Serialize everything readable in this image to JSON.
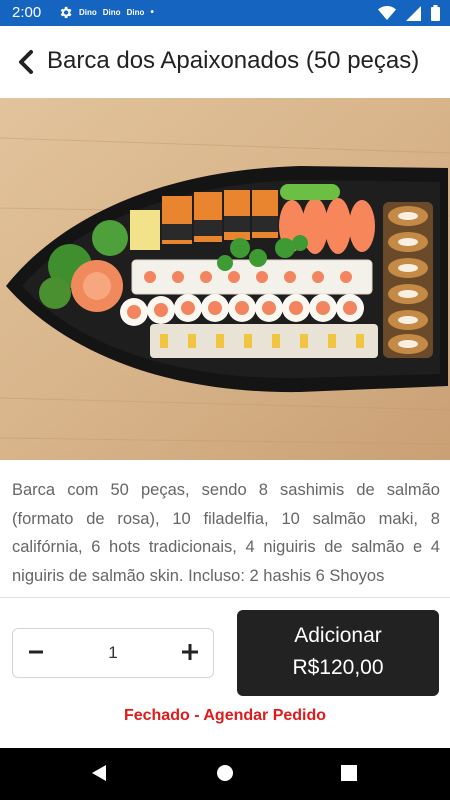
{
  "status_bar": {
    "time": "2:00",
    "notif_labels": [
      "Dino",
      "Dino",
      "Dino"
    ],
    "icons": [
      "gear-icon",
      "wifi-icon",
      "signal-icon",
      "battery-icon"
    ]
  },
  "header": {
    "title": "Barca dos Apaixonados (50 peças)",
    "back_icon": "chevron-left-icon"
  },
  "product": {
    "description": "Barca com 50 peças, sendo 8 sashimis de salmão (formato de rosa), 10 filadelfia, 10 salmão maki, 8 califórnia, 6 hots tradicionais, 4 niguiris de salmão e 4 niguiris de salmão skin. Incluso: 2 hashis 6 Shoyos"
  },
  "quantity": {
    "value": "1",
    "minus_icon": "minus-icon",
    "plus_icon": "plus-icon"
  },
  "add_button": {
    "label": "Adicionar",
    "price": "R$120,00"
  },
  "status_message": "Fechado - Agendar Pedido",
  "colors": {
    "status_bar": "#1565c0",
    "button": "#222222",
    "closed_text": "#e01b1b"
  }
}
